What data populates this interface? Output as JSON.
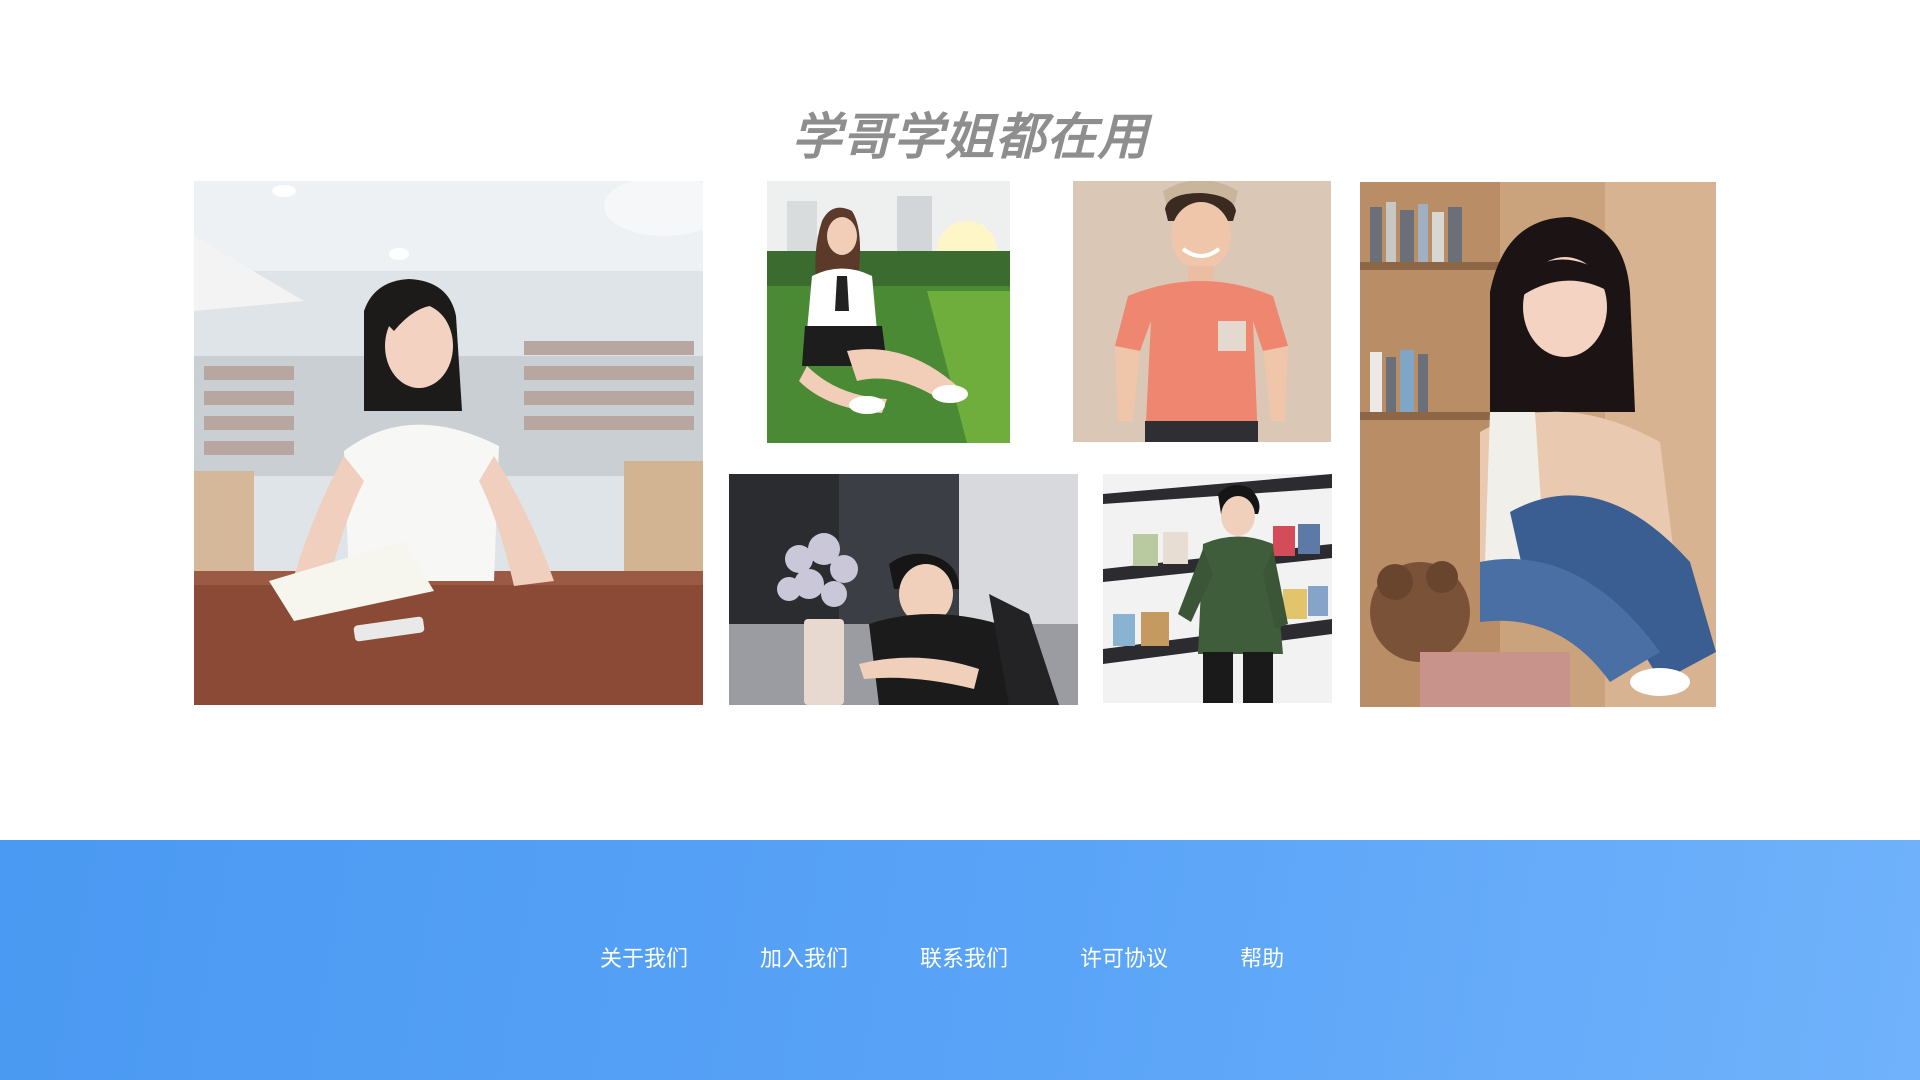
{
  "section": {
    "title": "学哥学姐都在用"
  },
  "gallery": {
    "photos": [
      {
        "name": "library-girl",
        "description": "girl reading a book in a library"
      },
      {
        "name": "lawn-girl",
        "description": "girl sitting on a lawn at sunset"
      },
      {
        "name": "tshirt-boy",
        "description": "smiling boy in a pink t-shirt"
      },
      {
        "name": "shelf-girl",
        "description": "girl in denim overalls by a bookshelf"
      },
      {
        "name": "desk-boy",
        "description": "boy leaning on a desk with flowers"
      },
      {
        "name": "jacket-boy",
        "description": "boy in a green jacket by magazine racks"
      }
    ]
  },
  "footer": {
    "links": [
      {
        "label": "关于我们"
      },
      {
        "label": "加入我们"
      },
      {
        "label": "联系我们"
      },
      {
        "label": "许可协议"
      },
      {
        "label": "帮助"
      }
    ]
  }
}
